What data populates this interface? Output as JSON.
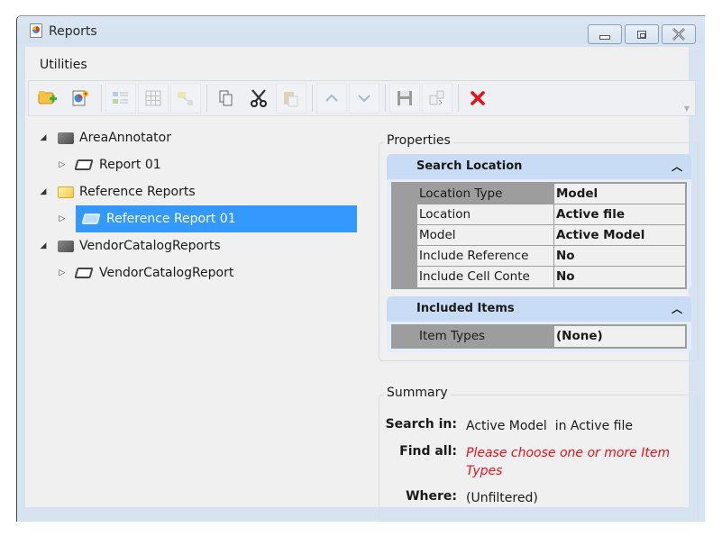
{
  "window": {
    "title": "Reports",
    "controls": [
      "minimize",
      "maximize",
      "close"
    ]
  },
  "menu": {
    "items": [
      "Utilities"
    ]
  },
  "toolbar": {
    "buttons": [
      {
        "name": "new-folder",
        "icon": "folder-plus-icon",
        "enabled": true
      },
      {
        "name": "new-report",
        "icon": "new-report-icon",
        "enabled": true
      },
      {
        "name": "columns",
        "icon": "columns-list-icon",
        "enabled": false
      },
      {
        "name": "table",
        "icon": "grid-icon",
        "enabled": false
      },
      {
        "name": "link",
        "icon": "link-icon",
        "enabled": false
      },
      {
        "name": "copy",
        "icon": "copy-icon",
        "enabled": true
      },
      {
        "name": "cut",
        "icon": "scissors-icon",
        "enabled": true
      },
      {
        "name": "paste",
        "icon": "paste-icon",
        "enabled": false
      },
      {
        "name": "move-up",
        "icon": "chevron-up-icon",
        "enabled": false
      },
      {
        "name": "move-down",
        "icon": "chevron-down-icon",
        "enabled": false
      },
      {
        "name": "save",
        "icon": "save-icon",
        "enabled": false
      },
      {
        "name": "export",
        "icon": "export-icon",
        "enabled": false
      },
      {
        "name": "delete",
        "icon": "delete-x-icon",
        "enabled": true
      }
    ]
  },
  "tree": {
    "nodes": [
      {
        "label": "AreaAnnotator",
        "level": 0,
        "type": "folder",
        "expanded": true
      },
      {
        "label": "Report 01",
        "level": 1,
        "type": "report",
        "expanded": false
      },
      {
        "label": "Reference Reports",
        "level": 0,
        "type": "folder-open",
        "expanded": true
      },
      {
        "label": "Reference Report 01",
        "level": 1,
        "type": "report",
        "expanded": false,
        "selected": true
      },
      {
        "label": "VendorCatalogReports",
        "level": 0,
        "type": "folder",
        "expanded": true
      },
      {
        "label": "VendorCatalogReport",
        "level": 1,
        "type": "report",
        "expanded": false
      }
    ]
  },
  "properties": {
    "label": "Properties",
    "search_location": {
      "header": "Search Location",
      "rows": [
        {
          "name": "Location Type",
          "value": "Model"
        },
        {
          "name": "Location",
          "value": "Active file"
        },
        {
          "name": "Model",
          "value": "Active Model"
        },
        {
          "name": "Include Reference",
          "value": "No"
        },
        {
          "name": "Include Cell Conte",
          "value": "No"
        }
      ]
    },
    "included_items": {
      "header": "Included Items",
      "rows": [
        {
          "name": "Item Types",
          "value": "(None)"
        }
      ]
    }
  },
  "summary": {
    "label": "Summary",
    "search_in_key": "Search in:",
    "search_in_value": "Active Model  in Active file",
    "find_all_key": "Find all:",
    "find_all_value": "Please choose one or more Item Types",
    "where_key": "Where:",
    "where_value": "(Unfiltered)",
    "warning_color": "#e8121c"
  },
  "colors": {
    "selection": "#3399ff",
    "section_header": "#c8ddf5"
  }
}
